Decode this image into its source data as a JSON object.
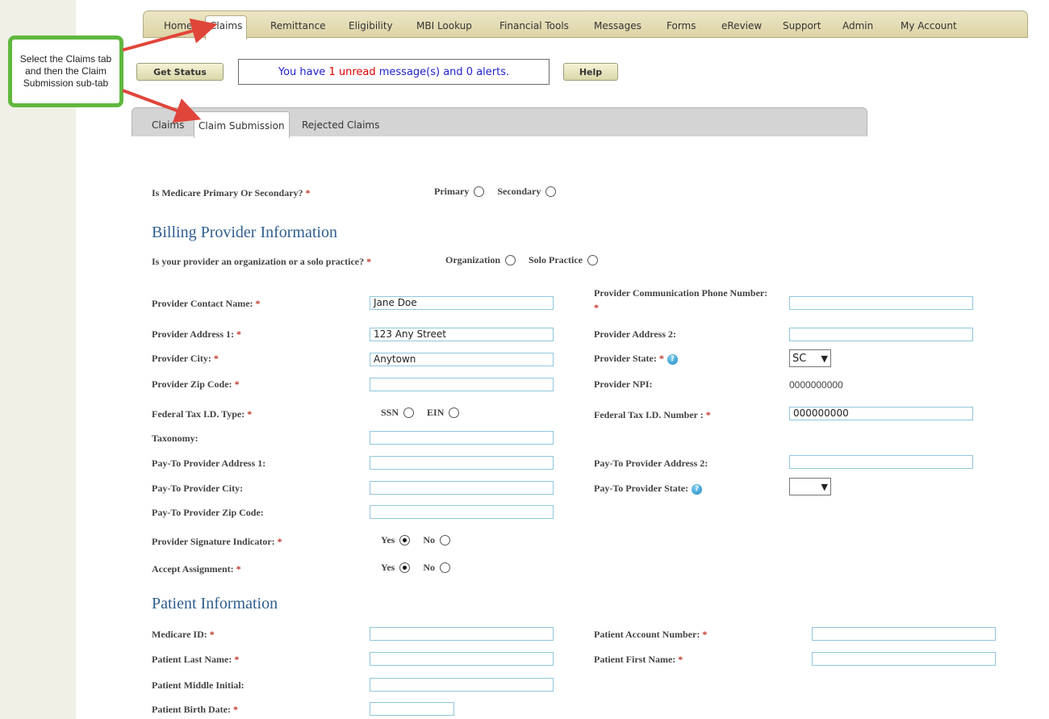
{
  "callout": {
    "text": "Select the Claims tab and then the Claim Submission sub-tab"
  },
  "top_tabs": [
    "Home",
    "Claims",
    "Remittance",
    "Eligibility",
    "MBI Lookup",
    "Financial Tools",
    "Messages",
    "Forms",
    "eReview",
    "Support",
    "Admin",
    "My Account"
  ],
  "active_top_tab": "Claims",
  "toolbar": {
    "get_status": "Get Status",
    "help": "Help",
    "message_prefix": "You have ",
    "unread_count": "1 unread",
    "message_suffix": " message(s) and 0 alerts."
  },
  "sub_tabs": [
    "Claims",
    "Claim Submission",
    "Rejected Claims"
  ],
  "active_sub_tab": "Claim Submission",
  "form": {
    "medicare_question": "Is Medicare Primary Or Secondary?",
    "primary": "Primary",
    "secondary": "Secondary",
    "billing_title": "Billing Provider Information",
    "org_question": "Is your provider an organization or a solo practice?",
    "organization": "Organization",
    "solo_practice": "Solo Practice",
    "contact_name_label": "Provider Contact Name:",
    "contact_name_value": "Jane Doe",
    "phone_label": "Provider Communication Phone Number:",
    "phone_value": "",
    "address1_label": "Provider Address 1:",
    "address1_value": "123 Any Street",
    "address2_label": "Provider Address 2:",
    "address2_value": "",
    "city_label": "Provider City:",
    "city_value": "Anytown",
    "state_label": "Provider State:",
    "state_value": "SC",
    "zip_label": "Provider Zip Code:",
    "zip_value": "",
    "npi_label": "Provider NPI:",
    "npi_value": "0000000000",
    "tax_type_label": "Federal Tax I.D. Type:",
    "ssn": "SSN",
    "ein": "EIN",
    "tax_number_label": "Federal Tax I.D. Number :",
    "tax_number_value": "000000000",
    "taxonomy_label": "Taxonomy:",
    "taxonomy_value": "",
    "payto_address1_label": "Pay-To Provider Address 1:",
    "payto_address1_value": "",
    "payto_address2_label": "Pay-To Provider Address 2:",
    "payto_address2_value": "",
    "payto_city_label": "Pay-To Provider City:",
    "payto_city_value": "",
    "payto_state_label": "Pay-To Provider State:",
    "payto_state_value": "",
    "payto_zip_label": "Pay-To Provider Zip Code:",
    "payto_zip_value": "",
    "signature_label": "Provider Signature Indicator:",
    "accept_label": "Accept Assignment:",
    "yes": "Yes",
    "no": "No",
    "patient_title": "Patient Information",
    "medicare_id_label": "Medicare ID:",
    "medicare_id_value": "",
    "patient_account_label": "Patient Account Number:",
    "patient_account_value": "",
    "last_name_label": "Patient Last Name:",
    "last_name_value": "",
    "first_name_label": "Patient First Name:",
    "first_name_value": "",
    "middle_initial_label": "Patient Middle Initial:",
    "middle_initial_value": "",
    "birth_date_label": "Patient Birth Date:",
    "birth_date_value": ""
  },
  "colors": {
    "accent": "#2f5e8f",
    "required": "#c0392b",
    "callout_border": "#5fb83e",
    "arrow": "#e0453a"
  }
}
